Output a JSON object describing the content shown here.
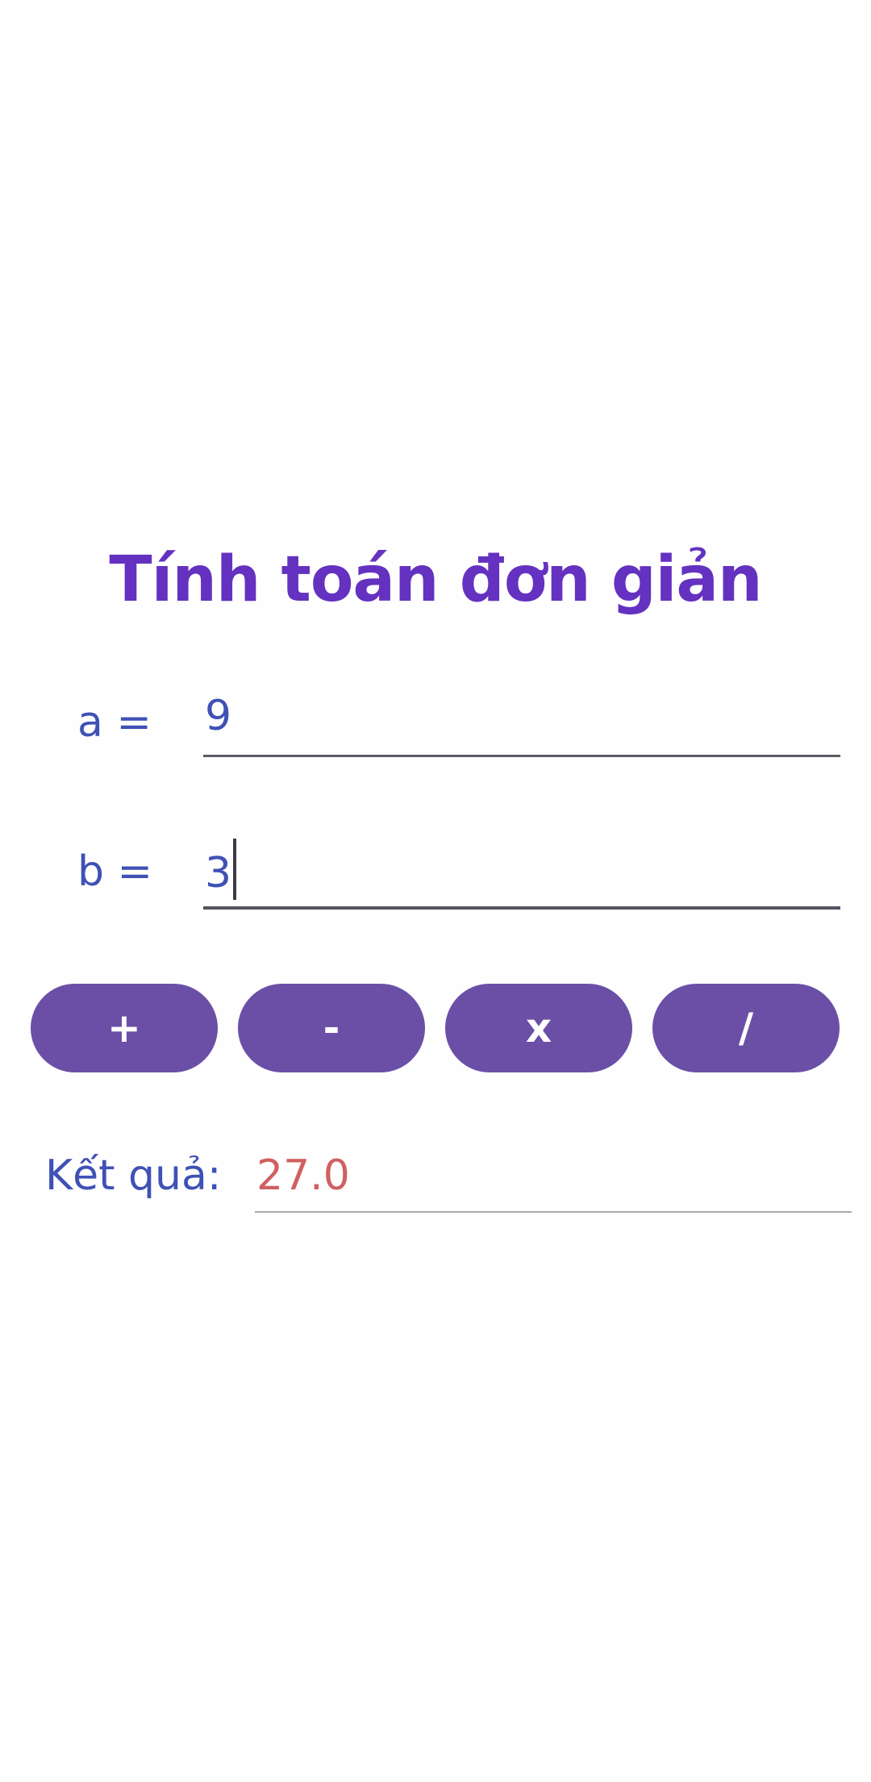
{
  "title": "Tính toán đơn giản",
  "input_a": {
    "label": "a =",
    "value": "9"
  },
  "input_b": {
    "label": "b =",
    "value": "3"
  },
  "operations": {
    "add": "+",
    "subtract": "-",
    "multiply": "x",
    "divide": "/"
  },
  "result": {
    "label": "Kết quả:",
    "value": "27.0"
  },
  "colors": {
    "title": "#6431c0",
    "label": "#3f51b5",
    "button": "#6b4fa6",
    "result_value": "#d06060"
  }
}
